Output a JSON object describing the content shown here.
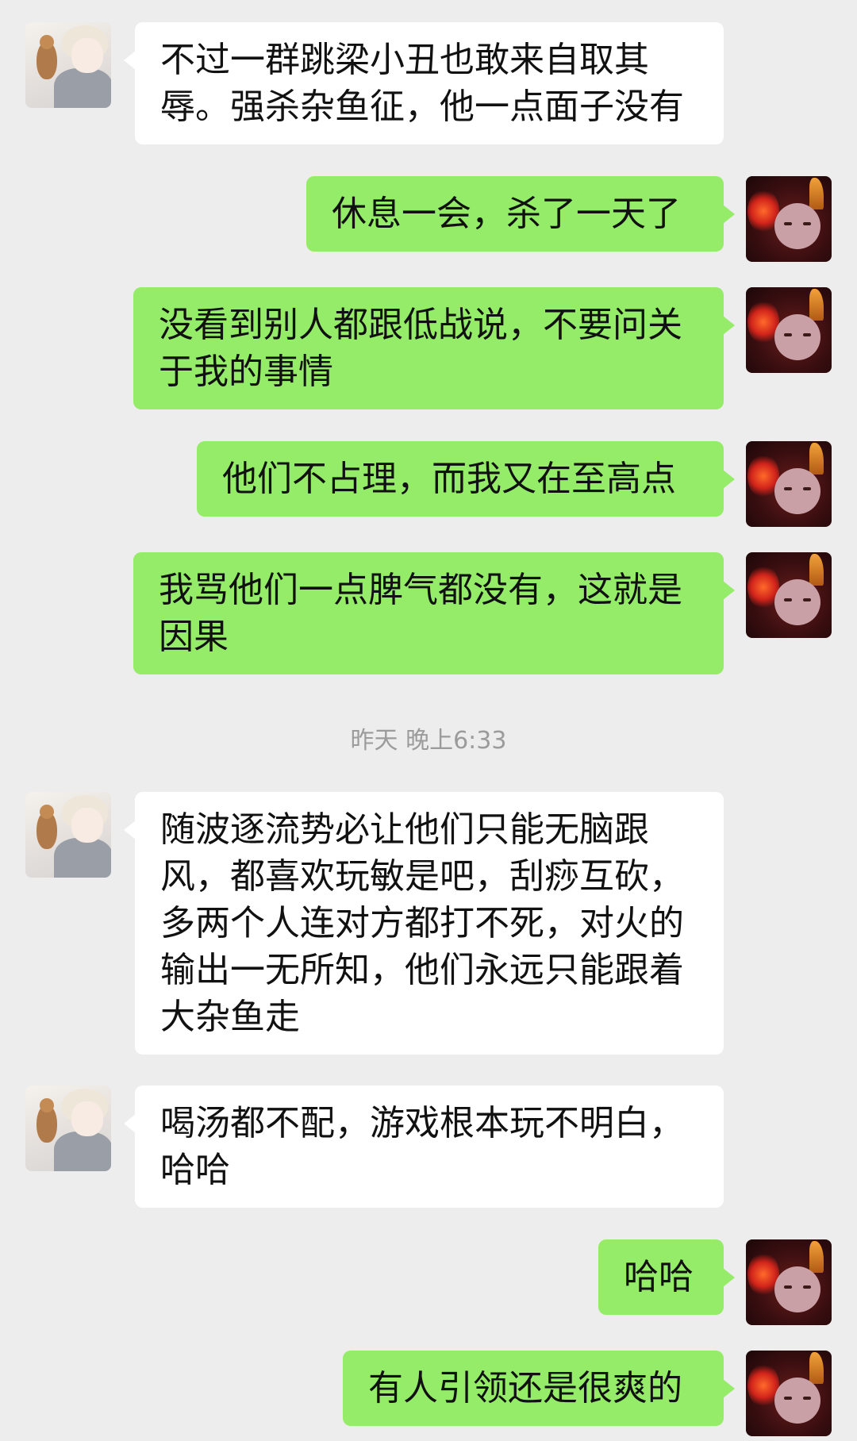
{
  "theme": {
    "background": "#ededed",
    "incoming_bubble": "#ffffff",
    "outgoing_bubble": "#95ec69",
    "timestamp_color": "#9b9b9b"
  },
  "avatars": {
    "contact": "boy-with-bird-avatar",
    "self": "red-devil-avatar"
  },
  "messages": [
    {
      "side": "in",
      "text": "不过一群跳梁小丑也敢来自取其辱。强杀杂鱼征，他一点面子没有"
    },
    {
      "side": "out",
      "text": "休息一会，杀了一天了"
    },
    {
      "side": "out",
      "text": "没看到别人都跟低战说，不要问关于我的事情"
    },
    {
      "side": "out",
      "text": "他们不占理，而我又在至高点"
    },
    {
      "side": "out",
      "text": "我骂他们一点脾气都没有，这就是因果"
    },
    {
      "side": "in",
      "text": "随波逐流势必让他们只能无脑跟风，都喜欢玩敏是吧，刮痧互砍，多两个人连对方都打不死，对火的输出一无所知，他们永远只能跟着大杂鱼走"
    },
    {
      "side": "in",
      "text": "喝汤都不配，游戏根本玩不明白，哈哈"
    },
    {
      "side": "out",
      "text": "哈哈"
    },
    {
      "side": "out",
      "text": "有人引领还是很爽的"
    }
  ],
  "timestamp": "昨天 晚上6:33"
}
